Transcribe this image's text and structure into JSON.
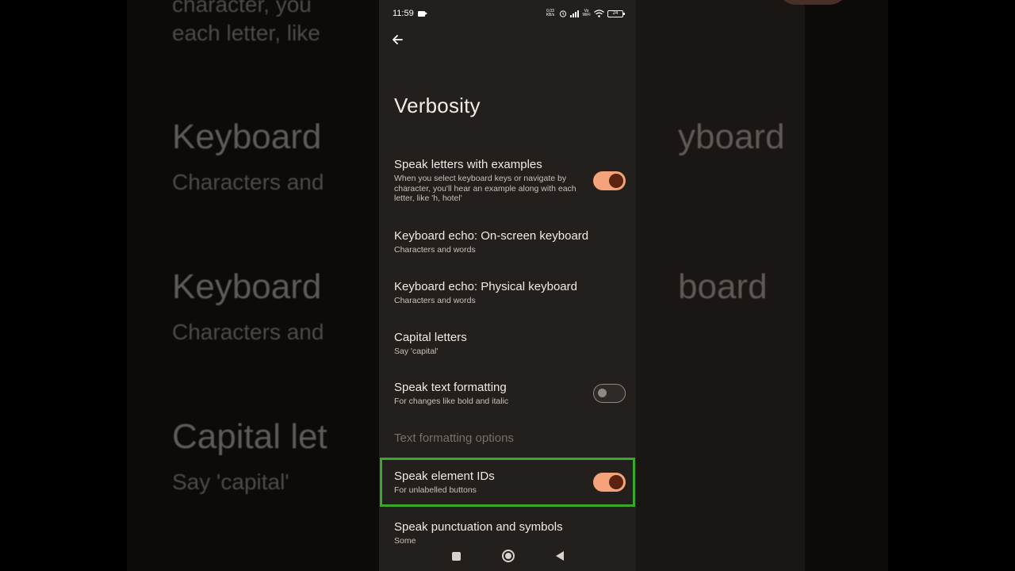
{
  "status_bar": {
    "time": "11:59",
    "net_speed": "0.03 KB/s",
    "volte": "Vo WiFi",
    "battery": "24"
  },
  "page": {
    "title": "Verbosity"
  },
  "settings": [
    {
      "title": "Speak letters with examples",
      "subtitle": "When you select keyboard keys or navigate by character, you'll hear an example along with each letter, like 'h, hotel'",
      "toggle": "on"
    },
    {
      "title": "Keyboard echo: On-screen keyboard",
      "subtitle": "Characters and words"
    },
    {
      "title": "Keyboard echo: Physical keyboard",
      "subtitle": "Characters and words"
    },
    {
      "title": "Capital letters",
      "subtitle": "Say 'capital'"
    },
    {
      "title": "Speak text formatting",
      "subtitle": "For changes like bold and italic",
      "toggle": "off"
    },
    {
      "title": "Text formatting options",
      "disabled": true
    },
    {
      "title": "Speak element IDs",
      "subtitle": "For unlabelled buttons",
      "toggle": "on",
      "highlighted": true
    },
    {
      "title": "Speak punctuation and symbols",
      "subtitle": "Some"
    }
  ],
  "background_blur": {
    "top_fragment_1": "character, you",
    "top_fragment_2": "each letter, like",
    "title_1": "Keyboard",
    "sub_1": "Characters and",
    "right_1": "yboard",
    "title_2": "Keyboard",
    "sub_2": "Characters and",
    "right_2": "board",
    "title_3": "Capital let",
    "sub_3": "Say 'capital'"
  },
  "colors": {
    "toggle_on_track": "#f5a37b",
    "toggle_on_knob": "#5c2410",
    "highlight_border": "#3aa62a",
    "background": "#231f1d"
  }
}
